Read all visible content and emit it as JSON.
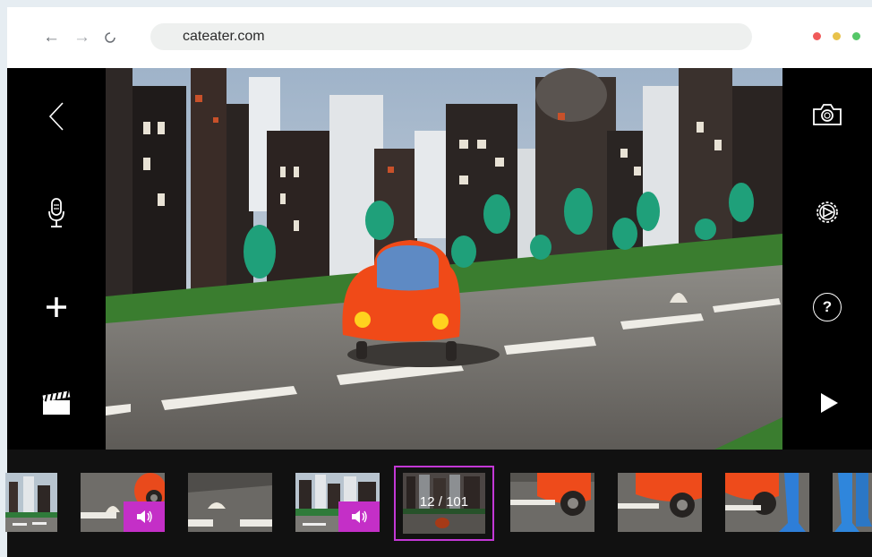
{
  "browser": {
    "url": "cateater.com",
    "icons": [
      "back-arrow-icon",
      "forward-arrow-icon",
      "reload-icon"
    ],
    "window_dots": [
      "#f05a5a",
      "#e8c24a",
      "#55c768"
    ]
  },
  "toolbar_left": {
    "icons": [
      "back-chevron-icon",
      "microphone-icon",
      "plus-icon",
      "clapperboard-icon"
    ]
  },
  "toolbar_right": {
    "icons": [
      "camera-icon",
      "settings-gear-icon",
      "help-icon",
      "play-icon"
    ],
    "help_label": "?"
  },
  "timeline": {
    "counter": "12 / 101",
    "current_frame": 12,
    "total_frames": 101,
    "accent_color": "#c338d6",
    "frames": [
      {
        "thumb": "city",
        "sound": false
      },
      {
        "thumb": "road-figure-car",
        "sound": true
      },
      {
        "thumb": "road-figure",
        "sound": false
      },
      {
        "thumb": "city",
        "sound": true
      },
      {
        "thumb": "city-dark",
        "selected": true
      },
      {
        "thumb": "car-wheel",
        "sound": false
      },
      {
        "thumb": "car-wheel",
        "sound": false
      },
      {
        "thumb": "car-blue-figure",
        "sound": false
      },
      {
        "thumb": "blue-figure",
        "sound": false
      }
    ]
  }
}
